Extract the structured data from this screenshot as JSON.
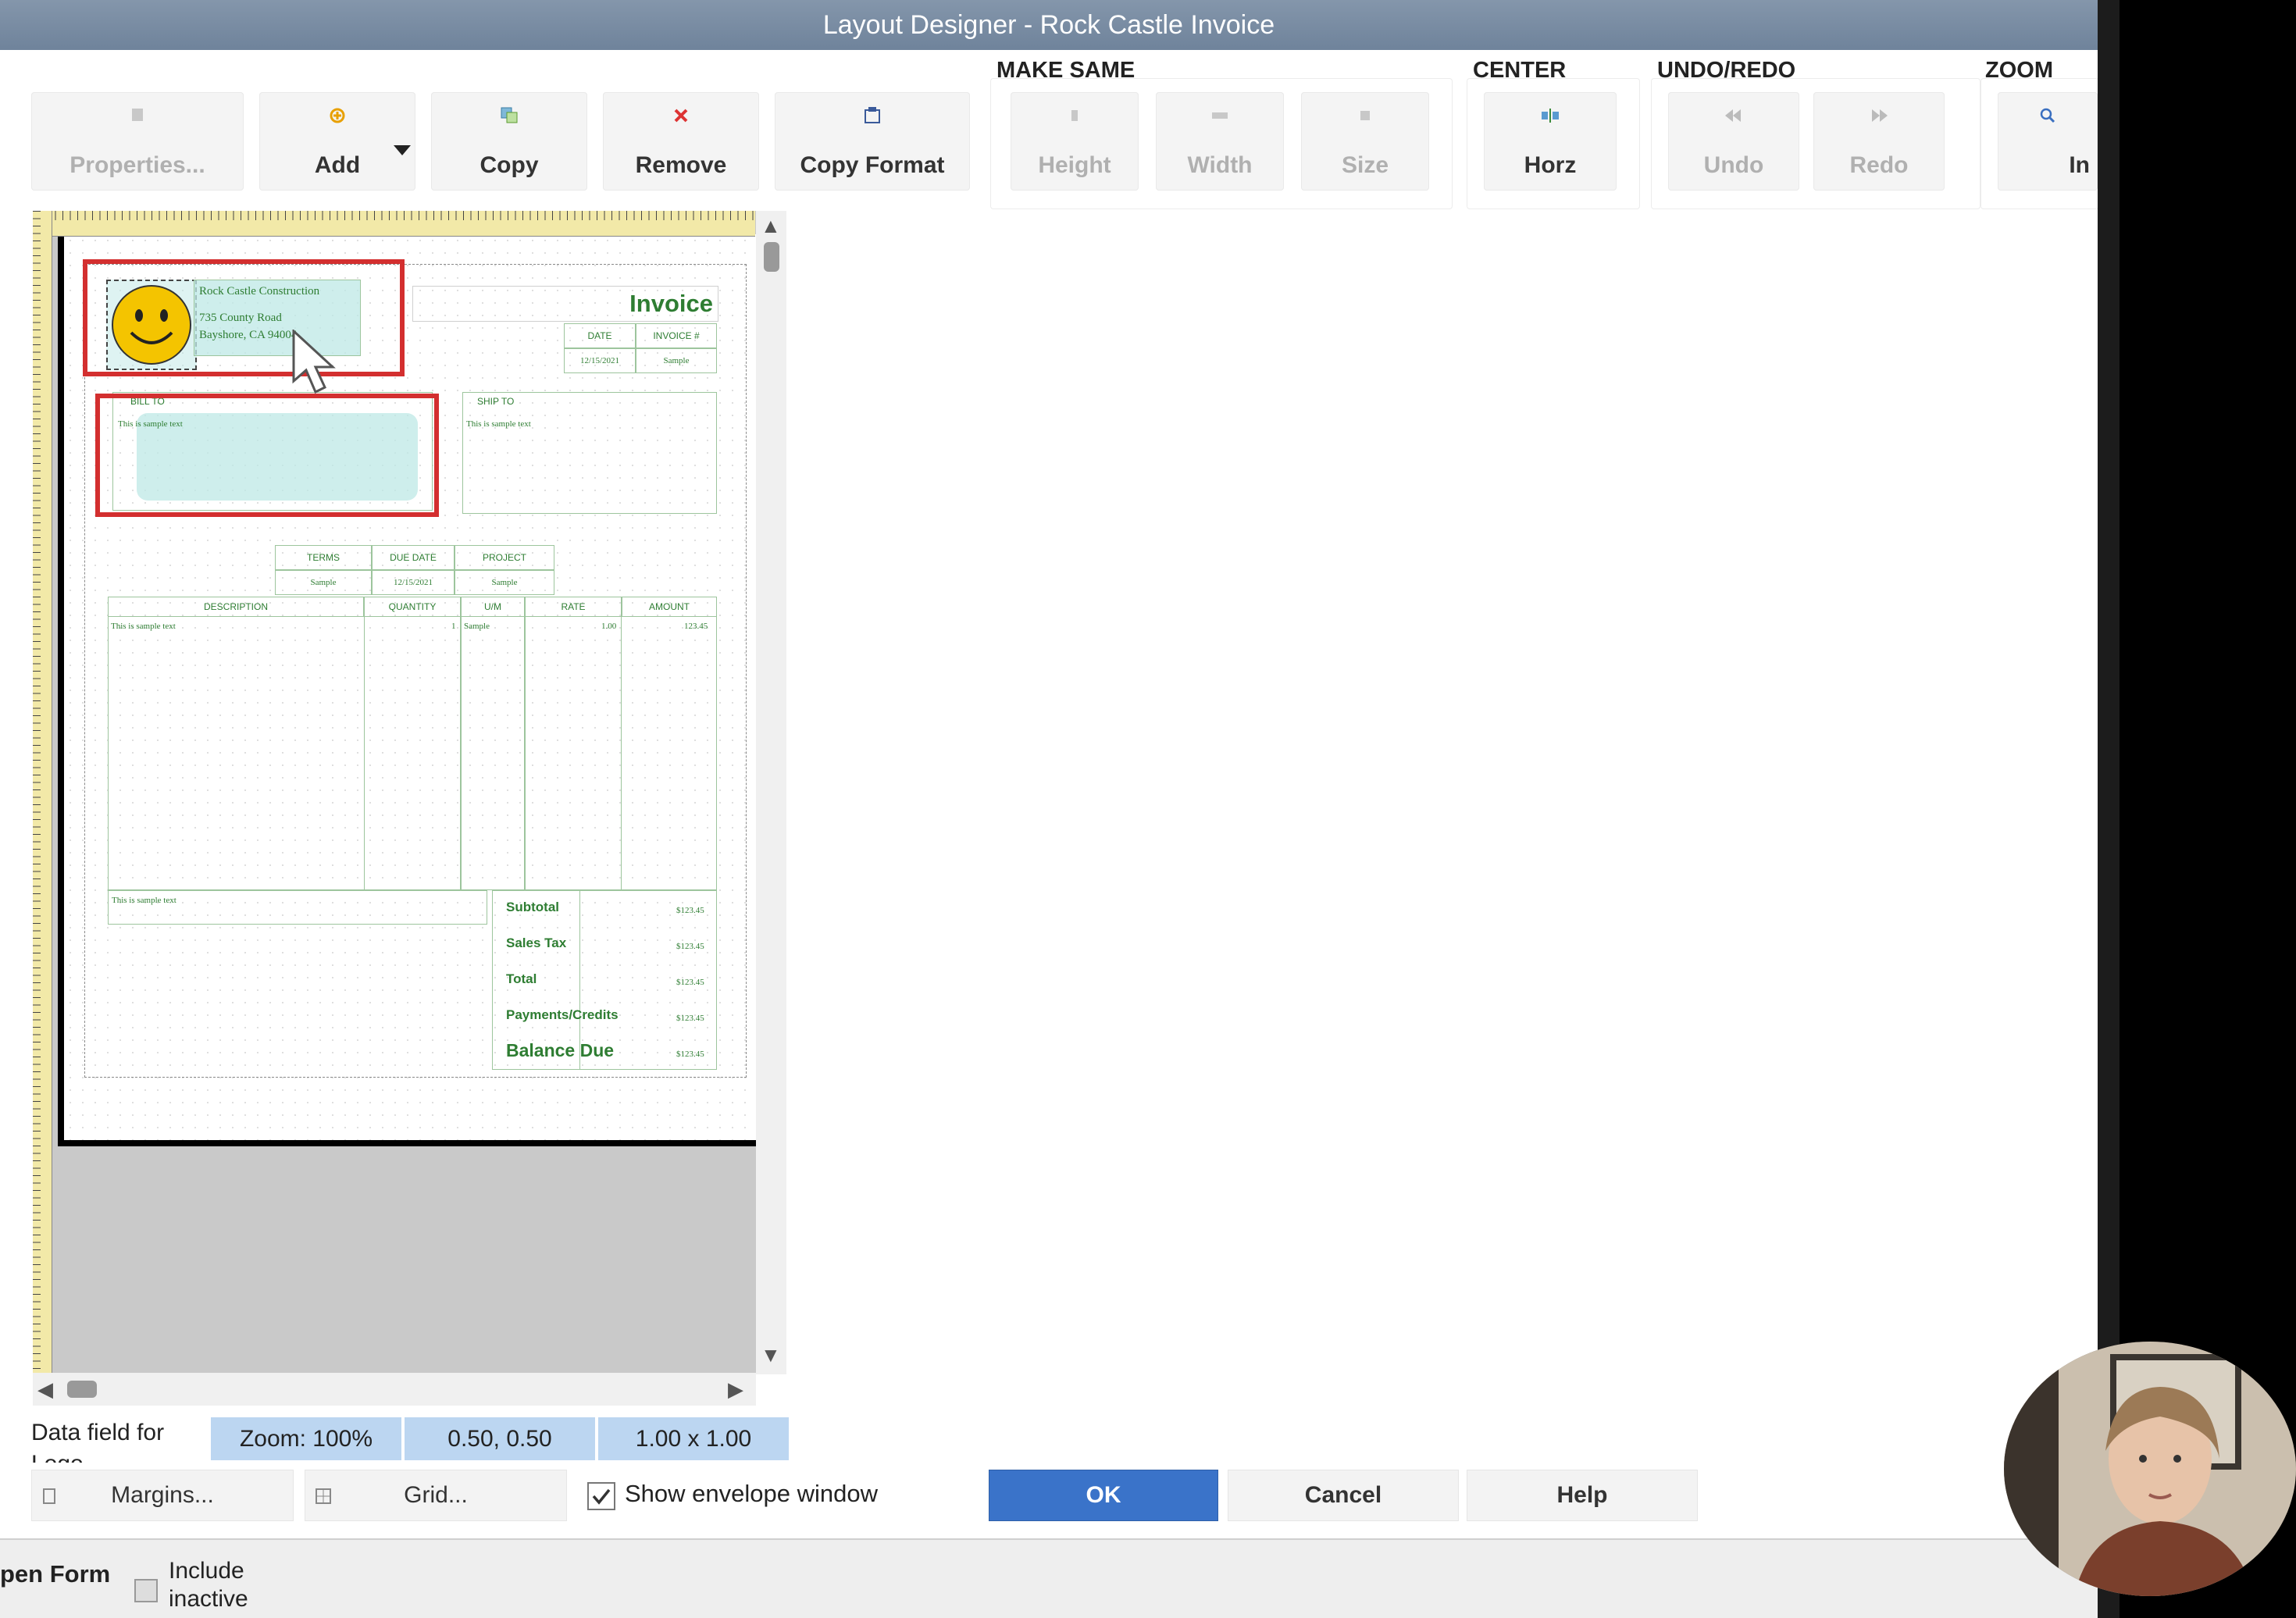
{
  "window": {
    "title": "Layout Designer - Rock Castle Invoice"
  },
  "toolbar": {
    "properties": "Properties...",
    "add": "Add",
    "copy": "Copy",
    "remove": "Remove",
    "copy_format": "Copy Format",
    "groups": {
      "make_same": "MAKE SAME",
      "center": "CENTER",
      "undo_redo": "UNDO/REDO",
      "zoom": "ZOOM"
    },
    "height": "Height",
    "width": "Width",
    "size": "Size",
    "horz": "Horz",
    "undo": "Undo",
    "redo": "Redo",
    "zoom_in": "In"
  },
  "invoice": {
    "company": "Rock Castle Construction",
    "address1": "735 County Road",
    "address2": "Bayshore, CA 94004",
    "title": "Invoice",
    "date_hdr": "DATE",
    "invoice_no_hdr": "INVOICE #",
    "date_val": "12/15/2021",
    "invoice_no_val": "Sample",
    "bill_to": "BILL TO",
    "ship_to": "SHIP TO",
    "sample_text": "This is sample text",
    "terms_hdr": "TERMS",
    "due_date_hdr": "DUE DATE",
    "project_hdr": "PROJECT",
    "terms_val": "Sample",
    "due_date_val": "12/15/2021",
    "project_val": "Sample",
    "col_description": "DESCRIPTION",
    "col_quantity": "QUANTITY",
    "col_um": "U/M",
    "col_rate": "RATE",
    "col_amount": "AMOUNT",
    "row_qty": "1",
    "row_um": "Sample",
    "row_rate": "1.00",
    "row_amount": "123.45",
    "subtotal": "Subtotal",
    "sales_tax": "Sales Tax",
    "total": "Total",
    "payments": "Payments/Credits",
    "balance_due": "Balance Due",
    "money": "$123.45"
  },
  "status": {
    "field_label": "Data field for Logo",
    "zoom": "Zoom: 100%",
    "position": "0.50, 0.50",
    "size": "1.00 x 1.00"
  },
  "buttons": {
    "margins": "Margins...",
    "grid": "Grid...",
    "show_envelope": "Show envelope window",
    "ok": "OK",
    "cancel": "Cancel",
    "help": "Help"
  },
  "bottom": {
    "open_form": "pen Form",
    "include_inactive": "Include inactive"
  },
  "colors": {
    "accent": "#3a73c9",
    "invoice_green": "#2e7d32",
    "highlight_red": "#d32f2f"
  }
}
